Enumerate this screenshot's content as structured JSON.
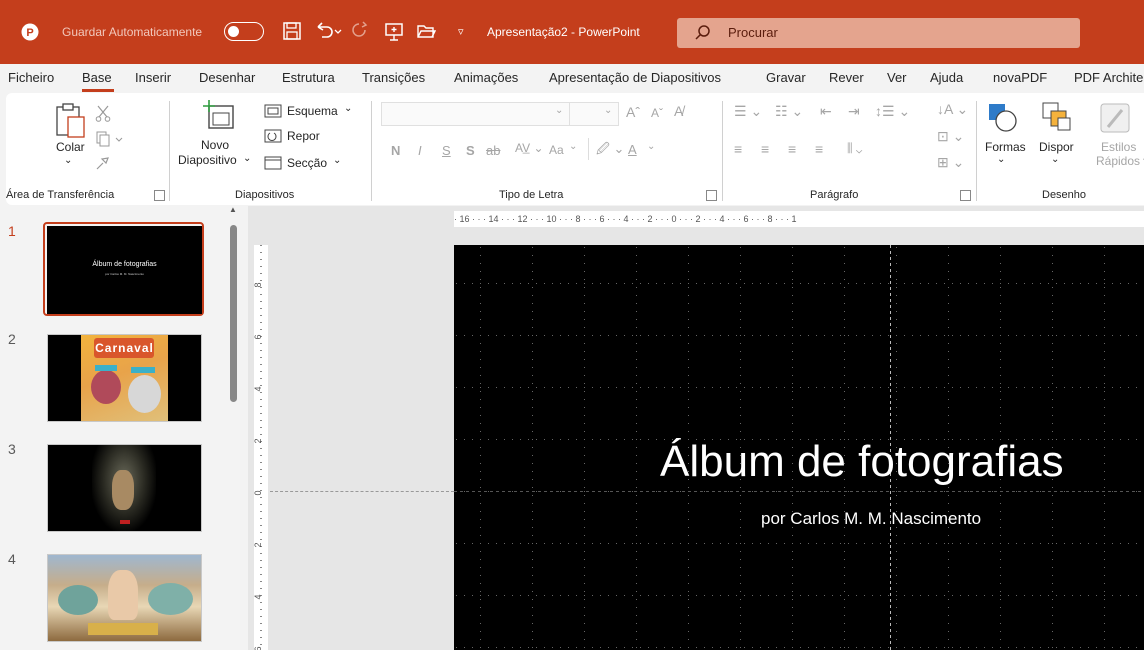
{
  "titlebar": {
    "autosave_label": "Guardar Automaticamente",
    "autosave_state": "off",
    "doc_title": "Apresentação2 - PowerPoint",
    "search_placeholder": "Procurar"
  },
  "menu": {
    "items": [
      "Ficheiro",
      "Base",
      "Inserir",
      "Desenhar",
      "Estrutura",
      "Transições",
      "Animações",
      "Apresentação de Diapositivos",
      "Gravar",
      "Rever",
      "Ver",
      "Ajuda",
      "novaPDF",
      "PDF Archite"
    ],
    "active": "Base"
  },
  "ribbon": {
    "clipboard": {
      "paste": "Colar",
      "group": "Área de Transferência"
    },
    "slides": {
      "new_slide_1": "Novo",
      "new_slide_2": "Diapositivo",
      "layout": "Esquema",
      "reset": "Repor",
      "section": "Secção",
      "group": "Diapositivos"
    },
    "font": {
      "bold": "N",
      "italic": "I",
      "underline": "S",
      "shadow": "S",
      "case": "Aa",
      "group": "Tipo de Letra"
    },
    "paragraph": {
      "group": "Parágrafo"
    },
    "drawing": {
      "shapes": "Formas",
      "arrange": "Dispor",
      "quick_styles_1": "Estilos",
      "quick_styles_2": "Rápidos",
      "group": "Desenho"
    }
  },
  "thumbnails": {
    "selected": 1,
    "items": [
      {
        "num": "1",
        "title": "Álbum de fotografias",
        "sub": "por Carlos M. M. Nascimento"
      },
      {
        "num": "2",
        "caption": "Carnaval"
      },
      {
        "num": "3"
      },
      {
        "num": "4"
      }
    ]
  },
  "ruler": {
    "horizontal": "· 16 · · · 14 · · · 12 · · · 10 · · · 8 · · · 6 · · · 4 · · · 2 · · · 0 · · · 2 · · · 4 · · · 6 · · · 8 · · · 1",
    "vertical": [
      "8",
      "6",
      "4",
      "2",
      "0",
      "2",
      "4",
      "6"
    ]
  },
  "slide": {
    "title": "Álbum de fotografias",
    "subtitle": "por Carlos M. M. Nascimento"
  },
  "colors": {
    "accent": "#c43e1c",
    "slide_bg": "#000000"
  }
}
